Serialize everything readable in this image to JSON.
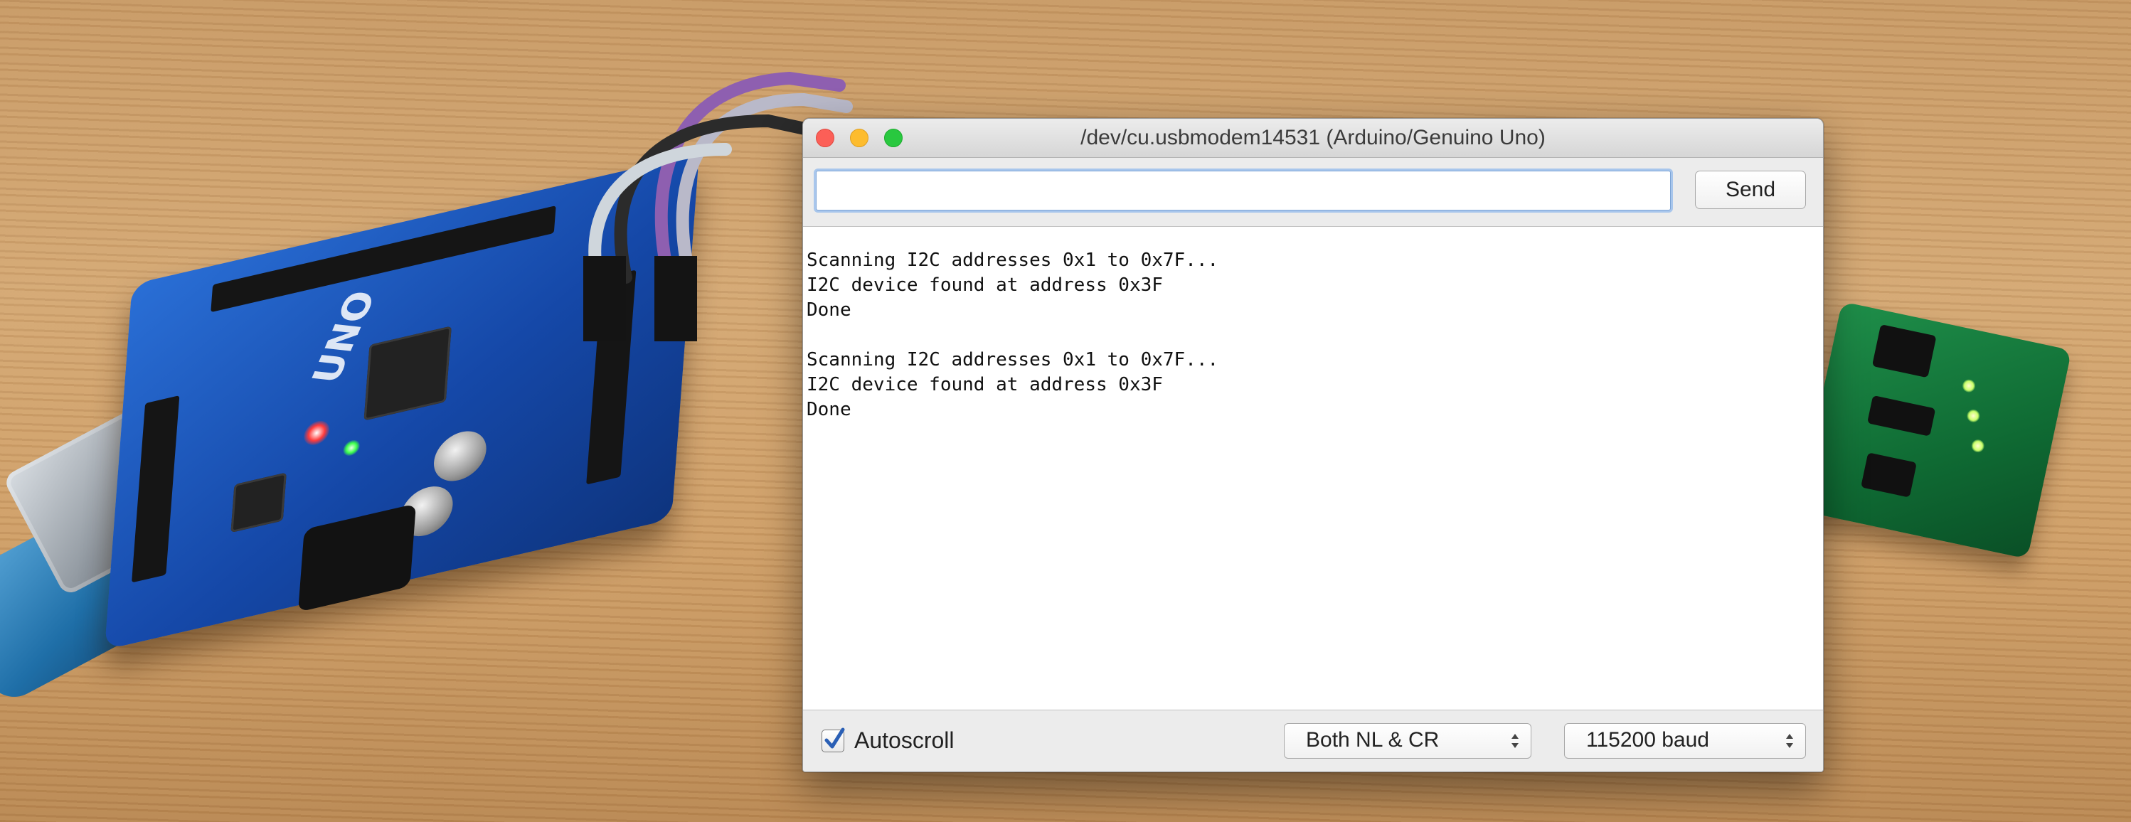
{
  "window": {
    "title": "/dev/cu.usbmodem14531 (Arduino/Genuino Uno)"
  },
  "input_row": {
    "input_value": "",
    "send_label": "Send"
  },
  "output": {
    "lines": [
      "Scanning I2C addresses 0x1 to 0x7F...",
      "I2C device found at address 0x3F",
      "Done",
      "",
      "Scanning I2C addresses 0x1 to 0x7F...",
      "I2C device found at address 0x3F",
      "Done"
    ]
  },
  "footer": {
    "autoscroll_label": "Autoscroll",
    "autoscroll_checked": true,
    "line_ending_selected": "Both NL & CR",
    "baud_selected": "115200 baud"
  },
  "board_silkscreen": {
    "model": "UNO"
  },
  "colors": {
    "close": "#fc5f57",
    "minimize": "#fdbc2e",
    "zoom": "#29c83f",
    "input_focus": "#a8c6ec",
    "checkmark": "#2a5fb5"
  }
}
